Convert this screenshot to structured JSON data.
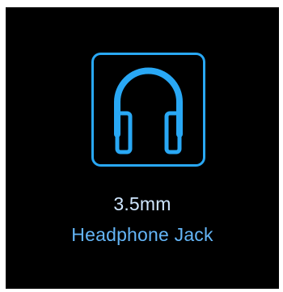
{
  "feature": {
    "icon": "headphones-icon",
    "line1": "3.5mm",
    "line2": "Headphone Jack"
  },
  "colors": {
    "background": "#000000",
    "icon_stroke": "#29a8f5",
    "text_primary": "#cfe6ff",
    "text_accent": "#64b5f6"
  }
}
